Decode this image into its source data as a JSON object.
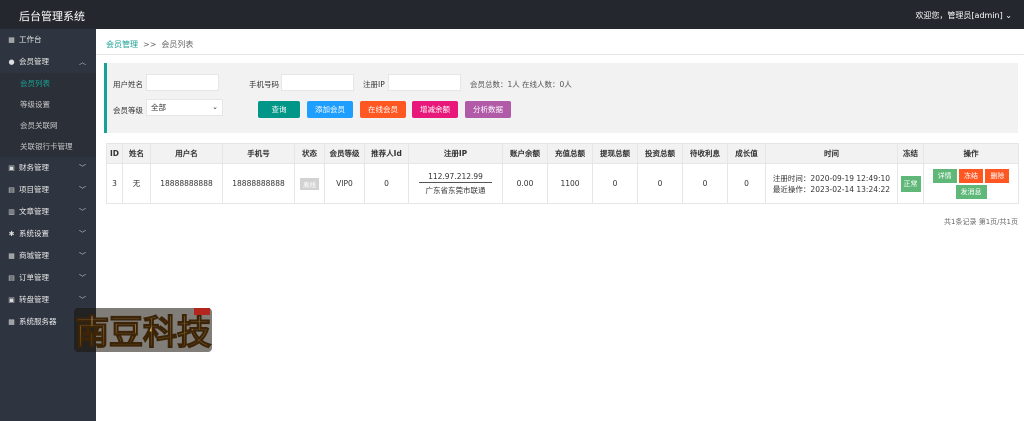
{
  "header": {
    "app_title": "后台管理系统",
    "user_text": "欢迎您，管理员[admin]",
    "user_dropdown_icon": "chevron-down-icon"
  },
  "sidebar": {
    "items": [
      {
        "label": "工作台",
        "icon": "grid-icon"
      },
      {
        "label": "会员管理",
        "icon": "user-icon",
        "expanded": true
      },
      {
        "label": "财务管理",
        "icon": "money-icon"
      },
      {
        "label": "项目管理",
        "icon": "folder-icon"
      },
      {
        "label": "文章管理",
        "icon": "document-icon"
      },
      {
        "label": "系统设置",
        "icon": "gear-icon"
      },
      {
        "label": "商城管理",
        "icon": "cart-icon"
      },
      {
        "label": "订单管理",
        "icon": "list-icon"
      },
      {
        "label": "转盘管理",
        "icon": "wheel-icon"
      },
      {
        "label": "系统服务器",
        "icon": "server-icon"
      }
    ],
    "sub_items": [
      {
        "label": "会员列表",
        "active": true
      },
      {
        "label": "等级设置"
      },
      {
        "label": "会员关联网"
      },
      {
        "label": "关联银行卡管理"
      }
    ],
    "active_color": "#1aa094"
  },
  "logo": {
    "text": "南豆科技"
  },
  "breadcrumb": {
    "parent": "会员管理",
    "separator": ">>",
    "current": "会员列表"
  },
  "filter": {
    "username_label": "用户姓名",
    "username_value": "",
    "phone_label": "手机号码",
    "phone_value": "",
    "ip_label": "注册IP",
    "ip_value": "",
    "level_label": "会员等级",
    "level_selected": "全部",
    "total_members": "会员总数：1人",
    "online_members": "在线人数：0人",
    "buttons": [
      {
        "label": "查询",
        "color": "#009688"
      },
      {
        "label": "添加会员",
        "color": "#1e9fff"
      },
      {
        "label": "在线会员",
        "color": "#ff5722"
      },
      {
        "label": "增减余额",
        "color": "#e8187a"
      },
      {
        "label": "分析数据",
        "color": "#b05aa8"
      }
    ]
  },
  "table": {
    "headers": [
      "ID",
      "姓名",
      "用户名",
      "手机号",
      "状态",
      "会员等级",
      "推荐人Id",
      "注册IP",
      "账户余额",
      "充值总额",
      "提现总额",
      "投资总额",
      "待收利息",
      "成长值",
      "时间",
      "冻结",
      "操作"
    ],
    "rows": [
      {
        "id": "3",
        "name": "无",
        "username": "18888888888",
        "phone": "18888888888",
        "status": "离线",
        "level": "VIP0",
        "referrer_id": "0",
        "ip": "112.97.212.99",
        "ip_location": "广东省东莞市联通",
        "balance": "0.00",
        "recharge_total": "1100",
        "withdraw_total": "0",
        "invest_total": "0",
        "pending_interest": "0",
        "growth": "0",
        "register_time": "注册时间：2020-09-19 12:49:10",
        "last_action": "最近操作：2023-02-14 13:24:22",
        "freeze": "正常",
        "actions": [
          {
            "label": "详情",
            "color": "#5fb878"
          },
          {
            "label": "冻结",
            "color": "#ff5722"
          },
          {
            "label": "删除",
            "color": "#ff5722"
          },
          {
            "label": "发消息",
            "color": "#5fb878"
          }
        ]
      }
    ]
  },
  "pagination": {
    "text": "共1条记录 第1页/共1页"
  }
}
